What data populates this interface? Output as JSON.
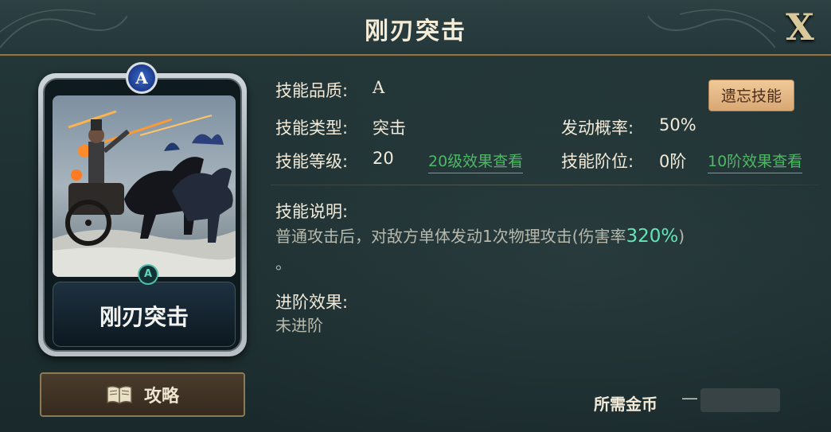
{
  "header": {
    "title": "刚刃突击",
    "close_label": "X"
  },
  "card": {
    "grade_badge": "A",
    "emblem": "A",
    "name": "刚刃突击"
  },
  "guide_button": {
    "label": "攻略",
    "icon": "book-icon"
  },
  "skill": {
    "quality_label": "技能品质:",
    "quality_value": "A",
    "type_label": "技能类型:",
    "type_value": "突击",
    "trigger_rate_label": "发动概率:",
    "trigger_rate_value": "50%",
    "level_label": "技能等级:",
    "level_value": "20",
    "level_effect_link": "20级效果查看",
    "tier_label": "技能阶位:",
    "tier_value": "0阶",
    "tier_effect_link": "10阶效果查看",
    "forget_button": "遗忘技能"
  },
  "description": {
    "title": "技能说明:",
    "text_before": "普通攻击后，对敌方单体发动1次物理攻击(伤害率",
    "highlight": "320%",
    "text_after": ")",
    "text_line2": "。"
  },
  "advance": {
    "title": "进阶效果:",
    "value": "未进阶"
  },
  "gold": {
    "label": "所需金币",
    "value": "—"
  },
  "colors": {
    "accent_gold": "#8a7a52",
    "link_green": "#4fb866",
    "highlight_green": "#63e6b5",
    "forget_button_bg": "#e6b887"
  }
}
